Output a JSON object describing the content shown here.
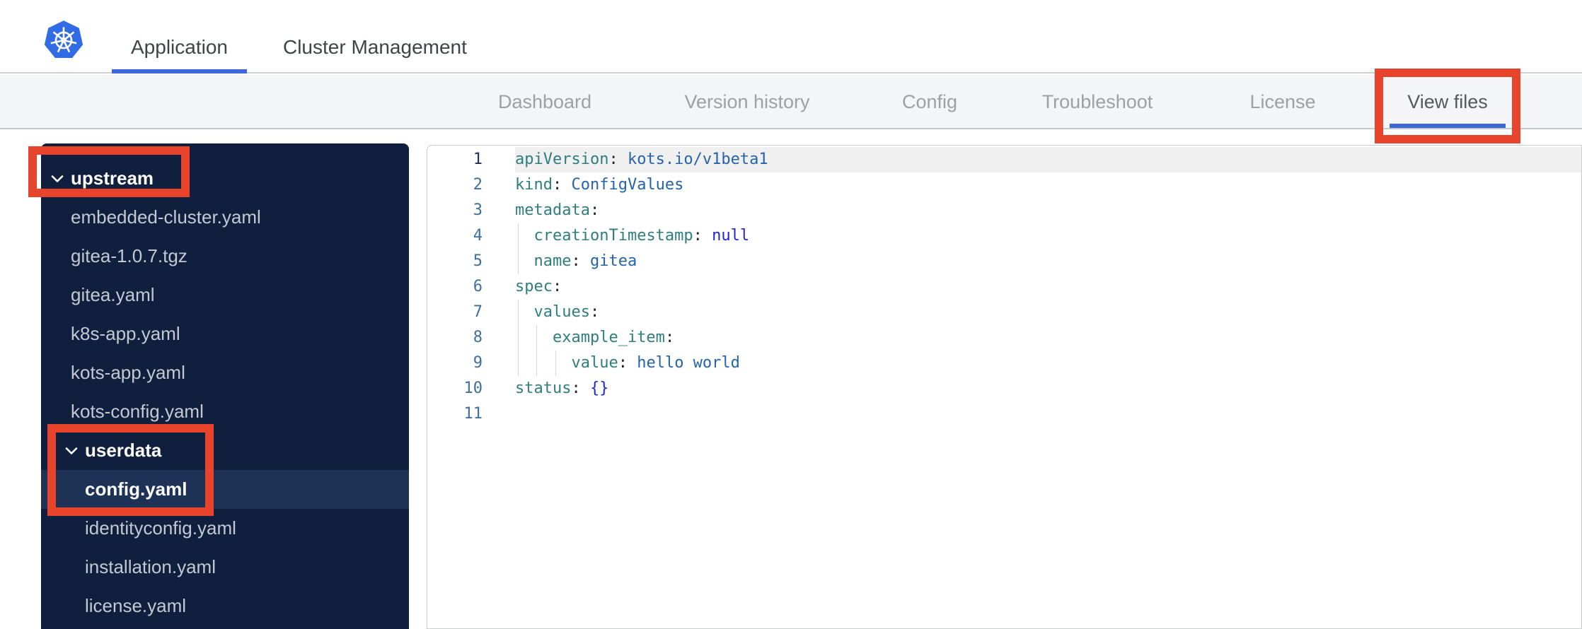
{
  "app": {
    "logo_icon": "kubernetes-logo"
  },
  "topbar": {
    "tabs": [
      {
        "label": "Application",
        "active": true
      },
      {
        "label": "Cluster Management",
        "active": false
      }
    ]
  },
  "navbar": {
    "tabs": [
      {
        "label": "Dashboard",
        "active": false
      },
      {
        "label": "Version history",
        "active": false
      },
      {
        "label": "Config",
        "active": false
      },
      {
        "label": "Troubleshoot",
        "active": false
      },
      {
        "label": "License",
        "active": false
      },
      {
        "label": "View files",
        "active": true
      }
    ]
  },
  "file_tree": {
    "items": [
      {
        "label": "upstream",
        "kind": "folder",
        "level": 1,
        "expanded": true,
        "selected": false
      },
      {
        "label": "embedded-cluster.yaml",
        "kind": "file",
        "level": 1,
        "selected": false
      },
      {
        "label": "gitea-1.0.7.tgz",
        "kind": "file",
        "level": 1,
        "selected": false
      },
      {
        "label": "gitea.yaml",
        "kind": "file",
        "level": 1,
        "selected": false
      },
      {
        "label": "k8s-app.yaml",
        "kind": "file",
        "level": 1,
        "selected": false
      },
      {
        "label": "kots-app.yaml",
        "kind": "file",
        "level": 1,
        "selected": false
      },
      {
        "label": "kots-config.yaml",
        "kind": "file",
        "level": 1,
        "selected": false
      },
      {
        "label": "userdata",
        "kind": "folder",
        "level": 2,
        "expanded": true,
        "selected": false
      },
      {
        "label": "config.yaml",
        "kind": "file",
        "level": 2,
        "selected": true
      },
      {
        "label": "identityconfig.yaml",
        "kind": "file",
        "level": 2,
        "selected": false
      },
      {
        "label": "installation.yaml",
        "kind": "file",
        "level": 2,
        "selected": false
      },
      {
        "label": "license.yaml",
        "kind": "file",
        "level": 2,
        "selected": false
      }
    ]
  },
  "code_viewer": {
    "language": "yaml",
    "lines": [
      {
        "number": 1,
        "active": true,
        "indent": 0,
        "tokens": [
          {
            "t": "key",
            "s": "apiVersion"
          },
          {
            "t": "punct",
            "s": ":"
          },
          {
            "t": "value",
            "s": " kots.io/v1beta1"
          }
        ]
      },
      {
        "number": 2,
        "active": false,
        "indent": 0,
        "tokens": [
          {
            "t": "key",
            "s": "kind"
          },
          {
            "t": "punct",
            "s": ":"
          },
          {
            "t": "value",
            "s": " ConfigValues"
          }
        ]
      },
      {
        "number": 3,
        "active": false,
        "indent": 0,
        "tokens": [
          {
            "t": "key",
            "s": "metadata"
          },
          {
            "t": "punct",
            "s": ":"
          }
        ]
      },
      {
        "number": 4,
        "active": false,
        "indent": 2,
        "tokens": [
          {
            "t": "key",
            "s": "creationTimestamp"
          },
          {
            "t": "punct",
            "s": ":"
          },
          {
            "t": "const",
            "s": " null"
          }
        ]
      },
      {
        "number": 5,
        "active": false,
        "indent": 2,
        "tokens": [
          {
            "t": "key",
            "s": "name"
          },
          {
            "t": "punct",
            "s": ":"
          },
          {
            "t": "value",
            "s": " gitea"
          }
        ]
      },
      {
        "number": 6,
        "active": false,
        "indent": 0,
        "tokens": [
          {
            "t": "key",
            "s": "spec"
          },
          {
            "t": "punct",
            "s": ":"
          }
        ]
      },
      {
        "number": 7,
        "active": false,
        "indent": 2,
        "tokens": [
          {
            "t": "key",
            "s": "values"
          },
          {
            "t": "punct",
            "s": ":"
          }
        ]
      },
      {
        "number": 8,
        "active": false,
        "indent": 4,
        "tokens": [
          {
            "t": "key",
            "s": "example_item"
          },
          {
            "t": "punct",
            "s": ":"
          }
        ]
      },
      {
        "number": 9,
        "active": false,
        "indent": 6,
        "tokens": [
          {
            "t": "key",
            "s": "value"
          },
          {
            "t": "punct",
            "s": ":"
          },
          {
            "t": "value",
            "s": " hello world"
          }
        ]
      },
      {
        "number": 10,
        "active": false,
        "indent": 0,
        "tokens": [
          {
            "t": "key",
            "s": "status"
          },
          {
            "t": "punct",
            "s": ":"
          },
          {
            "t": "const",
            "s": " {}"
          }
        ]
      },
      {
        "number": 11,
        "active": false,
        "indent": 0,
        "tokens": []
      }
    ]
  },
  "annotations": {
    "highlight_color": "#e8432b",
    "boxes": [
      "upstream-folder",
      "userdata-config-file",
      "view-files-tab"
    ]
  },
  "colors": {
    "accent_blue": "#3e68d8",
    "logo_blue": "#326ce5",
    "sidebar_bg": "#111f3e",
    "sidebar_selected_bg": "#1d3255",
    "key_color": "#2f7e7e",
    "value_color": "#2563af",
    "constant_color": "#2424dd"
  }
}
